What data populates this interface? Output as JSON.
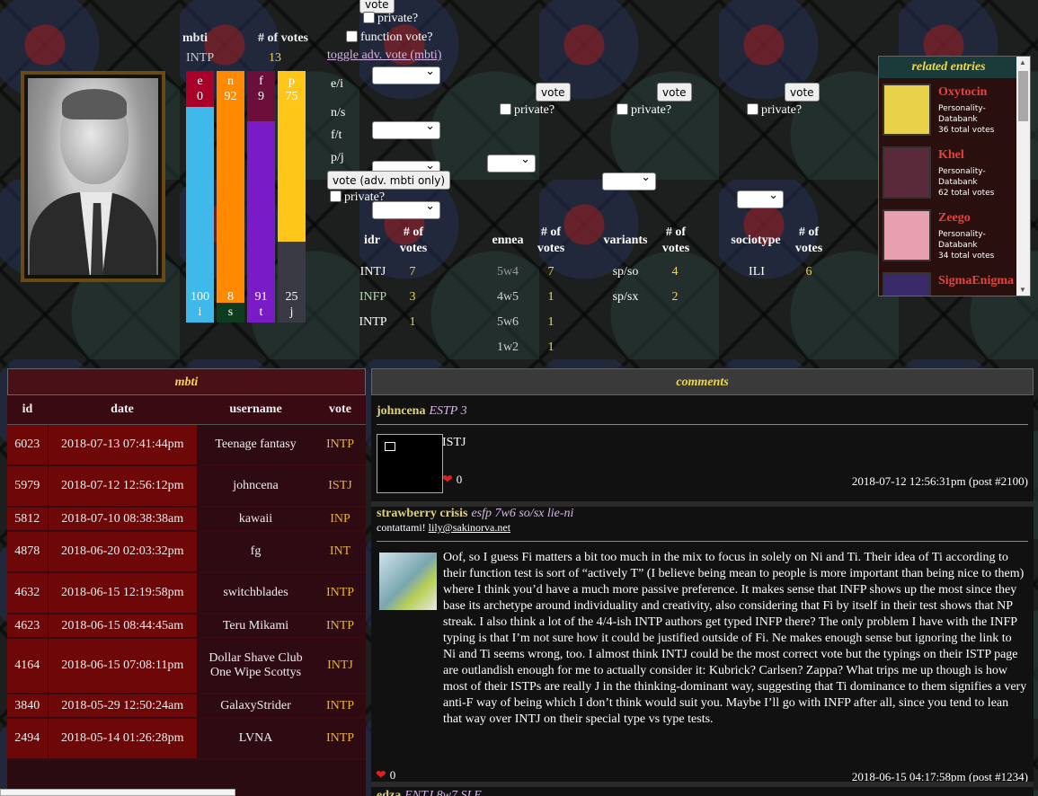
{
  "mbti_summary": {
    "header_type": "mbti",
    "header_votes": "# of votes",
    "top_type": "INTP",
    "top_count": "13",
    "bars": [
      {
        "top_letter": "e",
        "top_value": "0",
        "bottom_value": "100",
        "bottom_letter": "i",
        "top_pct": 0,
        "top_color": "#a9002a",
        "bottom_color": "#3fb8ea"
      },
      {
        "top_letter": "n",
        "top_value": "92",
        "bottom_value": "8",
        "bottom_letter": "s",
        "top_pct": 92,
        "top_color": "#ff8a00",
        "bottom_color": "#0d3d1e"
      },
      {
        "top_letter": "f",
        "top_value": "9",
        "bottom_value": "91",
        "bottom_letter": "t",
        "top_pct": 20,
        "top_color": "#6b0f3a",
        "bottom_color": "#7a1bc8"
      },
      {
        "top_letter": "p",
        "top_value": "75",
        "bottom_value": "25",
        "bottom_letter": "j",
        "top_pct": 68,
        "top_color": "#ffc61a",
        "bottom_color": "#3a3a44"
      }
    ]
  },
  "vote_form": {
    "vote_label": "vote",
    "private_label": "private?",
    "function_vote_label": "function vote?",
    "toggle_link": "toggle adv. vote (mbti)",
    "axes": [
      "e/i",
      "n/s",
      "f/t",
      "p/j"
    ],
    "adv_vote_button": "vote (adv. mbti only)"
  },
  "idr": {
    "headers": [
      "idr",
      "# of votes"
    ],
    "rows": [
      [
        "INTJ",
        "7"
      ],
      [
        "INFP",
        "3"
      ],
      [
        "INTP",
        "1"
      ]
    ]
  },
  "ennea": {
    "headers": [
      "ennea",
      "# of votes"
    ],
    "rows": [
      [
        "5w4",
        "7"
      ],
      [
        "4w5",
        "1"
      ],
      [
        "5w6",
        "1"
      ],
      [
        "1w2",
        "1"
      ]
    ]
  },
  "variants": {
    "headers": [
      "variants",
      "# of votes"
    ],
    "rows": [
      [
        "sp/so",
        "4"
      ],
      [
        "sp/sx",
        "2"
      ]
    ]
  },
  "sociotype": {
    "headers": [
      "sociotype",
      "# of votes"
    ],
    "rows": [
      [
        "ILI",
        "6"
      ]
    ]
  },
  "related": {
    "title": "related entries",
    "items": [
      {
        "name": "Oxytocin",
        "source": "Personality-Databank",
        "votes": "36 total votes",
        "thumb": "#e8d24a"
      },
      {
        "name": "Khel",
        "source": "Personality-Databank",
        "votes": "62 total votes",
        "thumb": "#5a2a3a"
      },
      {
        "name": "Zeego",
        "source": "Personality-Databank",
        "votes": "34 total votes",
        "thumb": "#e8a0b0"
      },
      {
        "name": "SigmaEnigma",
        "source": "",
        "votes": "",
        "thumb": "#3a2a6a"
      }
    ]
  },
  "mbti_table": {
    "title": "mbti",
    "columns": [
      "id",
      "date",
      "username",
      "vote"
    ],
    "rows": [
      {
        "id": "6023",
        "date": "2018-07-13 07:41:44pm",
        "user": "Teenage fantasy",
        "vote": "INTP"
      },
      {
        "id": "5979",
        "date": "2018-07-12 12:56:12pm",
        "user": "johncena",
        "vote": "ISTJ"
      },
      {
        "id": "5812",
        "date": "2018-07-10 08:38:38am",
        "user": "kawaii",
        "vote": "INP"
      },
      {
        "id": "4878",
        "date": "2018-06-20 02:03:32pm",
        "user": "fg",
        "vote": "INT"
      },
      {
        "id": "4632",
        "date": "2018-06-15 12:19:58pm",
        "user": "switchblades",
        "vote": "INTP"
      },
      {
        "id": "4623",
        "date": "2018-06-15 08:44:45am",
        "user": "Teru Mikami",
        "vote": "INTP"
      },
      {
        "id": "4164",
        "date": "2018-06-15 07:08:11pm",
        "user": "Dollar Shave Club One Wipe Scottys",
        "vote": "INTJ"
      },
      {
        "id": "3840",
        "date": "2018-05-29 12:50:24am",
        "user": "GalaxyStrider",
        "vote": "INTP"
      },
      {
        "id": "2494",
        "date": "2018-05-14 01:26:28pm",
        "user": "LVNA",
        "vote": "INTP"
      }
    ]
  },
  "comments": {
    "title": "comments",
    "items": [
      {
        "user": "johncena",
        "type": "ESTP 3",
        "subline": "",
        "text": "ISTJ",
        "likes": "0",
        "meta": "2018-07-12 12:56:31pm (post #2100)"
      },
      {
        "user": "strawberry crisis",
        "type": "esfp 7w6 so/sx lie-ni",
        "subline_prefix": "contattami! ",
        "subline_link": "lily@sakinorva.net",
        "text": "Oof, so I guess Fi matters a bit too much in the mix to focus in solely on Ni and Ti. Their idea of Ti according to their function test is sort of “actively T” (I believe being mean to people is more important than being nice to them) where I think you’d have a much more passive preference. It makes sense that INFP shows up the most since they base its archetype around individuality and creativity, also considering that Fi by itself in their test shows that NP streak. I also think a lot of the 4/4-ish INTP authors get typed INFP there? The only problem I have with the INFP typing is that I’m not sure how it could be justified outside of Fi. Ne makes enough sense but ignoring the link to Ni and Ti seems wrong, too. I almost think INTJ could be the most correct vote but the typings on their ISTP page are outlandish enough for me to actually consider it: Kubrick? Carlsen? Zappa? What trips me up though is how most of their ISTPs are really J in the thinking-dominant way, suggesting that Ti dominance to them signifies a very anti-F way of being which I don’t think would suit you. Maybe I’ll go with INFP after all, since you tend to lean that way over INTJ on their special type vs type tests.",
        "likes": "0",
        "meta": "2018-06-15 04:17:58pm (post #1234)"
      },
      {
        "user": "edza",
        "type": "ENTJ 8w7 SLE"
      }
    ]
  }
}
